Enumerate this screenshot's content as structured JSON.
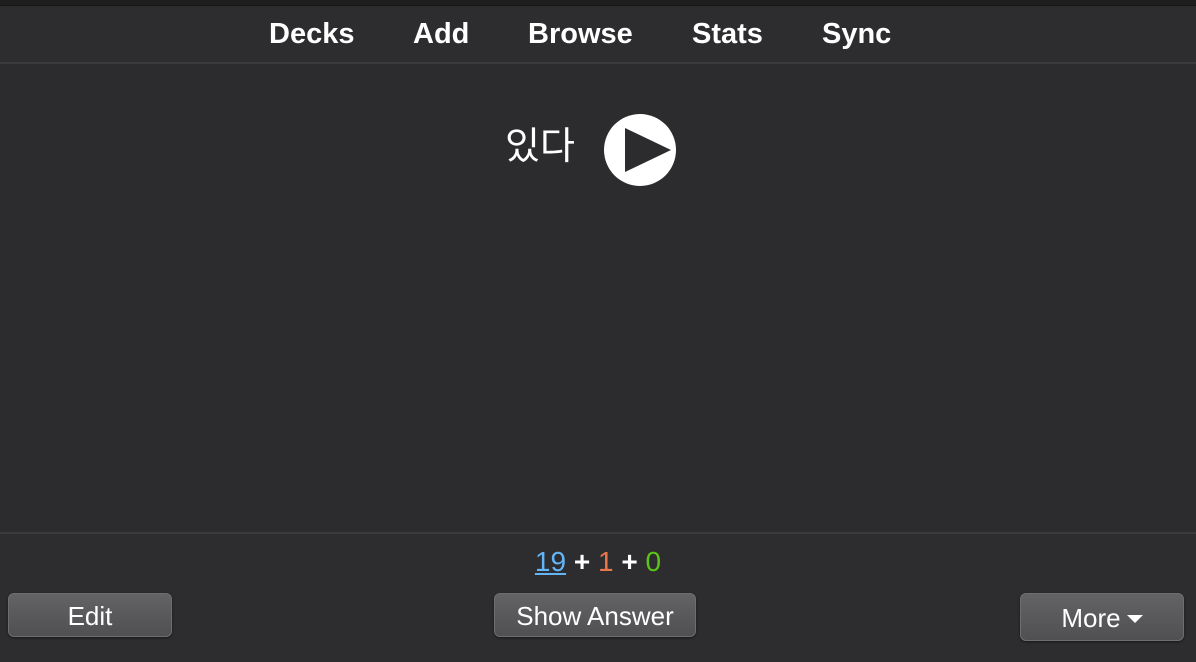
{
  "toolbar": {
    "items": [
      {
        "label": "Decks"
      },
      {
        "label": "Add"
      },
      {
        "label": "Browse"
      },
      {
        "label": "Stats"
      },
      {
        "label": "Sync"
      }
    ]
  },
  "card": {
    "front_text": "있다",
    "audio_icon": "play-icon"
  },
  "counts": {
    "new": "19",
    "learning": "1",
    "review": "0",
    "separator": "+"
  },
  "buttons": {
    "edit": "Edit",
    "show_answer": "Show Answer",
    "more": "More"
  },
  "colors": {
    "background": "#2c2c2e",
    "new_count": "#64b5f6",
    "learning_count": "#e8774a",
    "review_count": "#5cc415"
  }
}
